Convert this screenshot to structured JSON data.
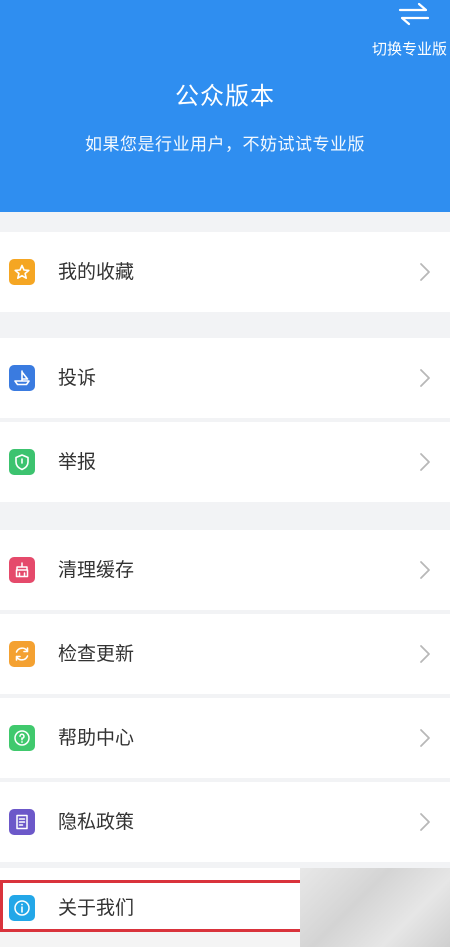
{
  "header": {
    "switch_label": "切换专业版",
    "title": "公众版本",
    "subtitle": "如果您是行业用户，不妨试试专业版",
    "color": "#2f8ef0"
  },
  "menu": {
    "favorites": {
      "label": "我的收藏",
      "icon": "star-icon",
      "color": "#f5a623"
    },
    "complaint": {
      "label": "投诉",
      "icon": "boat-icon",
      "color": "#3a7be0"
    },
    "report": {
      "label": "举报",
      "icon": "shield-icon",
      "color": "#3cc36f"
    },
    "clear_cache": {
      "label": "清理缓存",
      "icon": "broom-icon",
      "color": "#e54a6b"
    },
    "check_update": {
      "label": "检查更新",
      "icon": "refresh-icon",
      "color": "#f4a131"
    },
    "help": {
      "label": "帮助中心",
      "icon": "question-icon",
      "color": "#40c96d"
    },
    "privacy": {
      "label": "隐私政策",
      "icon": "document-icon",
      "color": "#6c58c9"
    },
    "about": {
      "label": "关于我们",
      "icon": "info-icon",
      "color": "#23a7e8"
    }
  }
}
